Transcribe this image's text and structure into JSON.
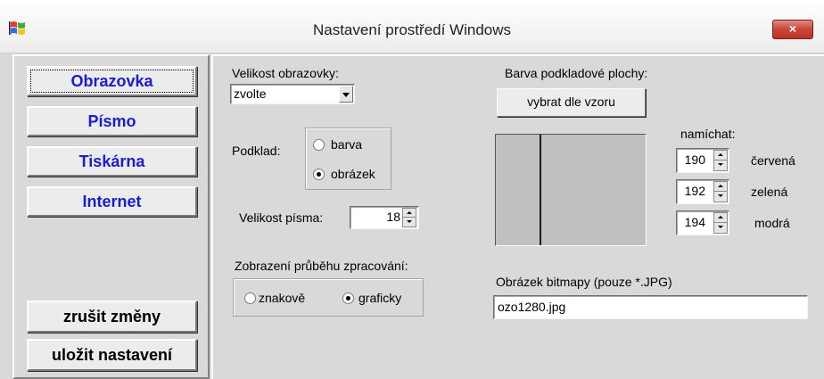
{
  "window": {
    "title": "Nastavení prostředí Windows",
    "close_label": "×"
  },
  "nav": {
    "items": [
      {
        "label": "Obrazovka",
        "active": true
      },
      {
        "label": "Písmo"
      },
      {
        "label": "Tiskárna"
      },
      {
        "label": "Internet"
      }
    ]
  },
  "actions": {
    "cancel_label": "zrušit změny",
    "save_label": "uložit nastavení"
  },
  "screen": {
    "size_label": "Velikost obrazovky:",
    "size_value": "zvolte",
    "background_label": "Podklad:",
    "background_options": [
      {
        "label": "barva",
        "checked": false
      },
      {
        "label": "obrázek",
        "checked": true
      }
    ],
    "font_size_label": "Velikost písma:",
    "font_size_value": "18",
    "progress_label": "Zobrazení průběhu zpracování:",
    "progress_options": [
      {
        "label": "znakově",
        "checked": false
      },
      {
        "label": "graficky",
        "checked": true
      }
    ]
  },
  "desktop": {
    "color_label": "Barva podkladové plochy:",
    "pick_button": "vybrat dle vzoru",
    "mix_label": "namíchat:",
    "rgb": [
      {
        "value": "190",
        "label": "červená"
      },
      {
        "value": "192",
        "label": "zelená"
      },
      {
        "value": "194",
        "label": "modrá"
      }
    ],
    "preview_color": "#c0c0c0",
    "bitmap_label": "Obrázek bitmapy (pouze *.JPG)",
    "bitmap_value": "ozo1280.jpg"
  },
  "colors": {
    "nav_text": "#1b1bd6",
    "face": "#d9d9d9",
    "close_red": "#c9473a"
  }
}
